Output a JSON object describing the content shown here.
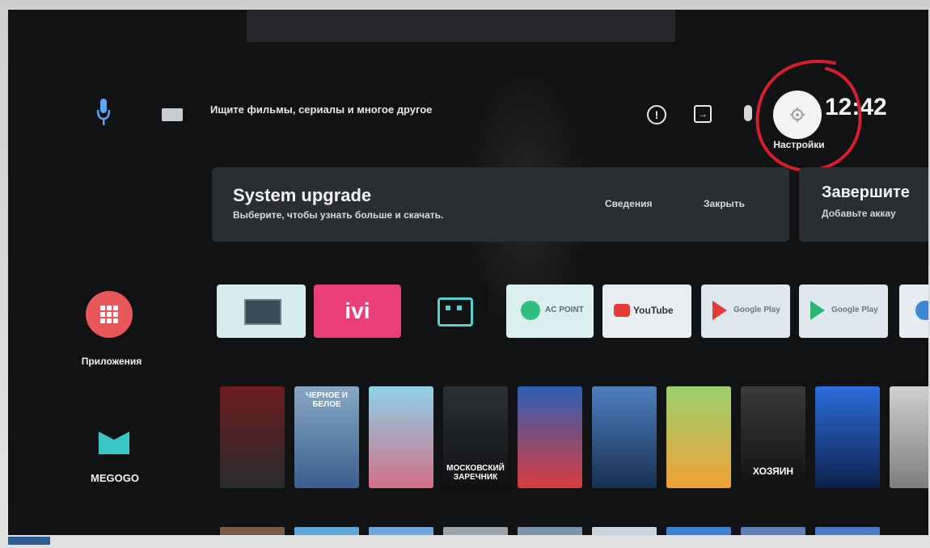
{
  "search": {
    "placeholder": "Ищите фильмы, сериалы и многое другое"
  },
  "top_bar": {
    "clock": "12:42",
    "settings_label": "Настройки",
    "icons": [
      "mic-icon",
      "keyboard-icon",
      "info-icon",
      "input-source-icon",
      "wifi-icon",
      "settings-gear-icon"
    ]
  },
  "cards": {
    "upgrade": {
      "title": "System upgrade",
      "subtitle": "Выберите, чтобы узнать больше и скачать.",
      "details_label": "Сведения",
      "close_label": "Закрыть"
    },
    "finish": {
      "title": "Завершите",
      "subtitle": "Добавьте аккау"
    }
  },
  "sidebar": {
    "apps_label": "Приложения",
    "megogo_label": "MEGOGO"
  },
  "apps_row": [
    {
      "name": "tv",
      "label": ""
    },
    {
      "name": "ivi",
      "label": "ivi"
    },
    {
      "name": "robot",
      "label": ""
    },
    {
      "name": "acpoint",
      "label": "AC POINT"
    },
    {
      "name": "youtube",
      "label": "YouTube"
    },
    {
      "name": "google-play-movies",
      "label": "Google Play"
    },
    {
      "name": "google-play-store",
      "label": "Google Play"
    },
    {
      "name": "more",
      "label": ""
    }
  ],
  "posters": [
    {
      "caption": ""
    },
    {
      "caption": "ЧЕРНОЕ И БЕЛОЕ"
    },
    {
      "caption": ""
    },
    {
      "caption": "МОСКОВСКИЙ ЗАРЕЧНИК"
    },
    {
      "caption": ""
    },
    {
      "caption": ""
    },
    {
      "caption": ""
    },
    {
      "caption": "ХОЗЯИН"
    },
    {
      "caption": ""
    },
    {
      "caption": ""
    }
  ],
  "colors": {
    "background": "#111214",
    "card": "#2a2d32",
    "apps_accent": "#e8575a",
    "ivi_pink": "#ea3e7a",
    "megogo_teal": "#38c7c4",
    "annotation_red": "#d41f2a"
  }
}
